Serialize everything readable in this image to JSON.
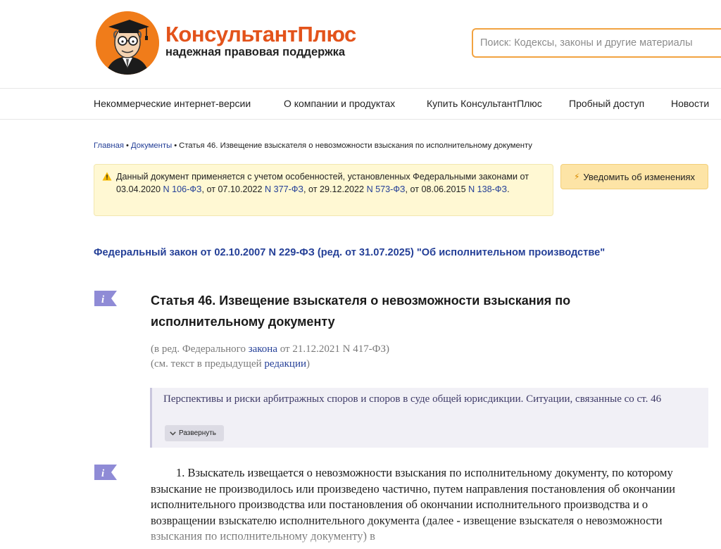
{
  "header": {
    "logo_title": "КонсультантПлюс",
    "logo_subtitle": "надежная правовая поддержка",
    "search_placeholder": "Поиск: Кодексы, законы и другие материалы"
  },
  "nav": {
    "items": [
      {
        "label": "Некоммерческие интернет-версии"
      },
      {
        "label": "О компании и продуктах"
      },
      {
        "label": "Купить КонсультантПлюс"
      },
      {
        "label": "Пробный доступ"
      },
      {
        "label": "Новости"
      }
    ]
  },
  "breadcrumb": {
    "home": "Главная",
    "docs": "Документы",
    "current": "Статья 46. Извещение взыскателя о невозможности взыскания по исполнительному документу",
    "separator": "•"
  },
  "warning": {
    "prefix": "Данный документ применяется с учетом особенностей, установленных Федеральными законами от 03.04.2020 ",
    "law1": "N 106-ФЗ",
    "mid1": ", от 07.10.2022 ",
    "law2": "N 377-ФЗ",
    "mid2": ", от 29.12.2022 ",
    "law3": "N 573-ФЗ",
    "mid3": ", от 08.06.2015 ",
    "law4": "N 138-ФЗ",
    "suffix": "."
  },
  "notify_button": {
    "label": "Уведомить об изменениях"
  },
  "law_title": "Федеральный закон от 02.10.2007 N 229-ФЗ (ред. от 31.07.2025) \"Об исполнительном производстве\"",
  "article": {
    "title": "Статья 46. Извещение взыскателя о невозможности взыскания по исполнительному документу",
    "edition_prefix": "(в ред. Федерального ",
    "edition_link": "закона",
    "edition_suffix": " от 21.12.2021 N 417-ФЗ)",
    "prev_prefix": "(см. текст в предыдущей ",
    "prev_link": "редакции",
    "prev_suffix": ")"
  },
  "perspectives": {
    "text": "Перспективы и риски арбитражных споров и споров в суде общей юрисдикции. Ситуации, связанные со ст. 46",
    "expand_label": "Развернуть"
  },
  "paragraph": {
    "text": "1. Взыскатель извещается о невозможности взыскания по исполнительному документу, по которому взыскание не производилось или произведено частично, путем направления постановления об окончании исполнительного производства или постановления об окончании исполнительного производства и о возвращении взыскателю исполнительного документа (далее - извещение взыскателя о невозможности взыскания по исполнительному документу) в"
  },
  "colors": {
    "brand_orange": "#e3531b",
    "link_blue": "#243f97",
    "warning_bg": "#fff8d3",
    "button_bg": "#fde4a6",
    "info_icon": "#8f8bd6"
  }
}
